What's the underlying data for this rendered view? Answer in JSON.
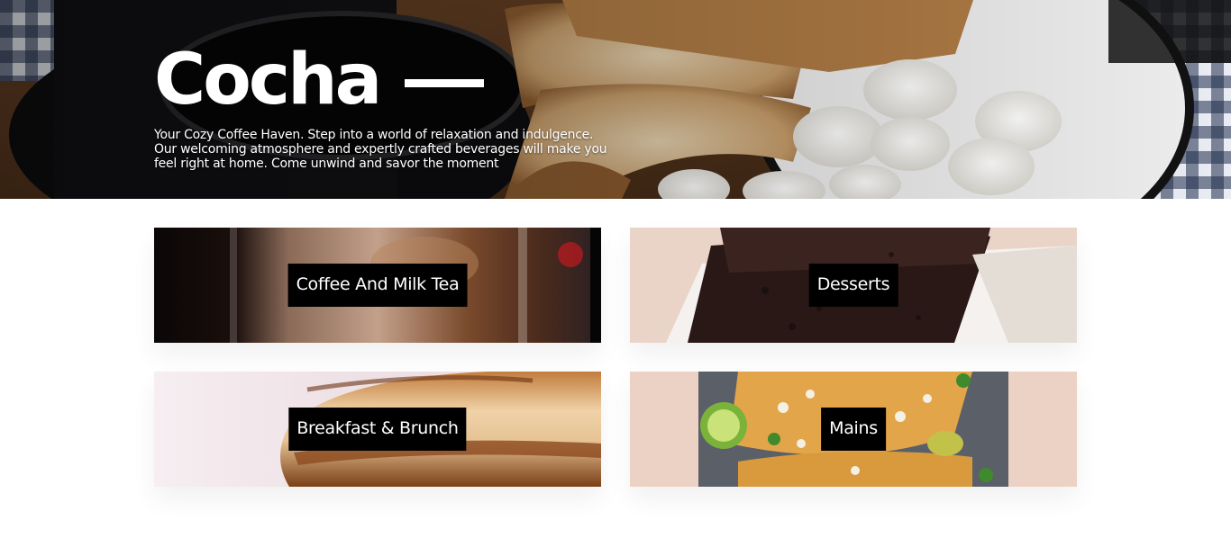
{
  "hero": {
    "title": "Cocha",
    "description": "Your Cozy Coffee Haven. Step into a world of relaxation and indulgence. Our welcoming atmosphere and expertly crafted beverages will make you feel right at home. Come unwind and savor the moment"
  },
  "categories": [
    {
      "label": "Coffee And Milk Tea"
    },
    {
      "label": "Desserts"
    },
    {
      "label": "Breakfast & Brunch"
    },
    {
      "label": "Mains"
    }
  ],
  "colors": {
    "label_background": "#000000",
    "label_text": "#ffffff",
    "page_background": "#ffffff"
  }
}
